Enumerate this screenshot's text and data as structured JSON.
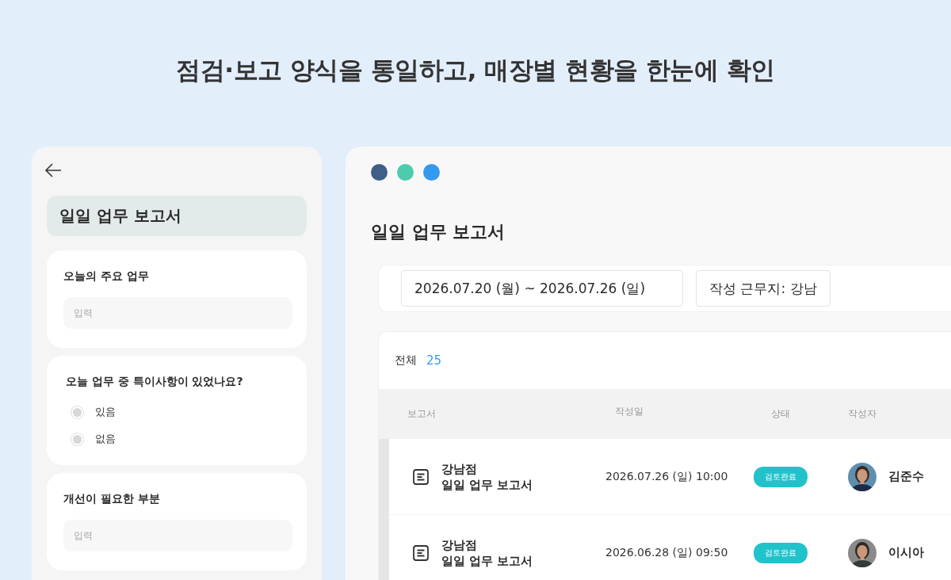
{
  "headline": "점검·보고 양식을 통일하고, 매장별 현황을 한눈에 확인",
  "mobile_form": {
    "title": "일일 업무 보고서",
    "questions": [
      {
        "kind": "text",
        "label": "오늘의 주요 업무",
        "placeholder": "입력"
      },
      {
        "kind": "radio",
        "label": "오늘 업무 중 특이사항이 있었나요?",
        "options": [
          {
            "label": "있음",
            "selected": false
          },
          {
            "label": "없음",
            "selected": false
          }
        ]
      },
      {
        "kind": "text",
        "label": "개선이 필요한 부분",
        "placeholder": "입력"
      }
    ]
  },
  "desktop": {
    "title": "일일 업무 보고서",
    "filters": [
      "2026.07.20 (월) ~ 2026.07.26 (일)",
      "작성 근무지: 강남"
    ],
    "total_label": "전체",
    "total_count": "25",
    "table": {
      "columns": [
        "보고서",
        "작성일",
        "상태",
        "작성자"
      ],
      "rows": [
        {
          "store": "강남점",
          "report": "일일 업무 보고서",
          "date": "2026.07.26 (일) 10:00",
          "status": "검토완료",
          "author": "김준수"
        },
        {
          "store": "강남점",
          "report": "일일 업무 보고서",
          "date": "2026.06.28 (일) 09:50",
          "status": "검토완료",
          "author": "이시아"
        }
      ]
    }
  }
}
